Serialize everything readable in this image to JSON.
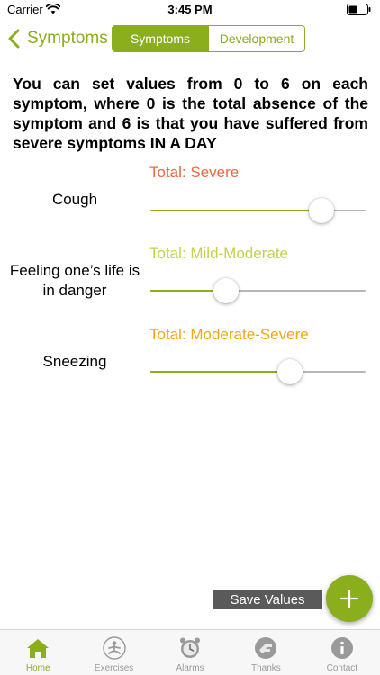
{
  "status_bar": {
    "carrier": "Carrier",
    "time": "3:45 PM"
  },
  "nav": {
    "back_label": "Symptoms",
    "segments": [
      {
        "label": "Symptoms",
        "selected": true
      },
      {
        "label": "Development",
        "selected": false
      }
    ]
  },
  "instructions": "You can set values from 0 to 6 on each symptom, where 0 is the total absence of the symptom and 6 is that you have suffered from severe symptoms IN A DAY",
  "symptoms": [
    {
      "name": "Cough",
      "total": "Total: Severe",
      "total_color": "#e8693c",
      "value": 5,
      "max": 6
    },
    {
      "name": "Feeling one’s life is in danger",
      "total": "Total: Mild-Moderate",
      "total_color": "#c3d24a",
      "value": 2,
      "max": 6
    },
    {
      "name": "Sneezing",
      "total": "Total: Moderate-Severe",
      "total_color": "#f2a51a",
      "value": 4,
      "max": 6
    }
  ],
  "actions": {
    "save_label": "Save Values",
    "add_icon": "plus-icon"
  },
  "tabs": [
    {
      "label": "Home",
      "icon": "home-icon",
      "active": true
    },
    {
      "label": "Exercises",
      "icon": "meditation-icon",
      "active": false
    },
    {
      "label": "Alarms",
      "icon": "alarm-clock-icon",
      "active": false
    },
    {
      "label": "Thanks",
      "icon": "thanks-icon",
      "active": false
    },
    {
      "label": "Contact",
      "icon": "info-icon",
      "active": false
    }
  ],
  "colors": {
    "accent": "#8aae1c",
    "track": "#b7b7b7",
    "tab_inactive": "#9a9a9a"
  }
}
